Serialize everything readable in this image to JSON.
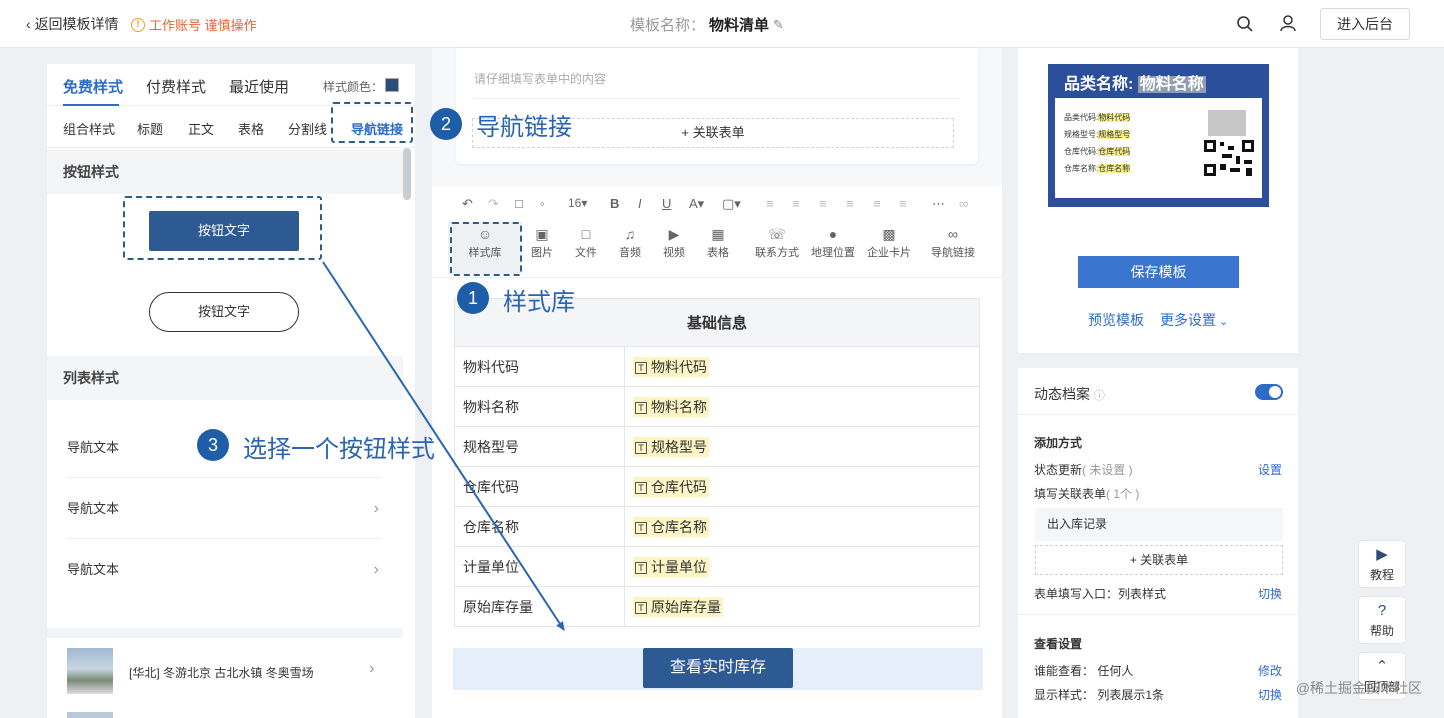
{
  "topbar": {
    "back_label": "返回模板详情",
    "warning_text": "工作账号 谨慎操作",
    "template_name_label": "模板名称：",
    "template_name": "物料清单",
    "enter_button": "进入后台"
  },
  "left_panel": {
    "tabs": [
      "免费样式",
      "付费样式",
      "最近使用"
    ],
    "style_color_label": "样式颜色：",
    "subtabs": [
      "组合样式",
      "标题",
      "正文",
      "表格",
      "分割线",
      "导航链接"
    ],
    "button_section_title": "按钮样式",
    "button_filled_label": "按钮文字",
    "button_outline_label": "按钮文字",
    "list_section_title": "列表样式",
    "nav_items": [
      "导航文本",
      "导航文本",
      "导航文本"
    ],
    "news_item": "[华北] 冬游北京 古北水镇 冬奥雪场"
  },
  "middle": {
    "hint_text": "请仔细填写表单中的内容",
    "add_linked_form": "+ 关联表单",
    "font_size": "16",
    "tools": [
      "样式库",
      "图片",
      "文件",
      "音频",
      "视频",
      "表格",
      "联系方式",
      "地理位置",
      "企业卡片",
      "导航链接"
    ],
    "table_title": "基础信息",
    "rows": [
      {
        "key": "物料代码",
        "value": "物料代码"
      },
      {
        "key": "物料名称",
        "value": "物料名称"
      },
      {
        "key": "规格型号",
        "value": "规格型号"
      },
      {
        "key": "仓库代码",
        "value": "仓库代码"
      },
      {
        "key": "仓库名称",
        "value": "仓库名称"
      },
      {
        "key": "计量单位",
        "value": "计量单位"
      },
      {
        "key": "原始库存量",
        "value": "原始库存量"
      }
    ],
    "query_button": "查看实时库存"
  },
  "right_panel": {
    "label_title": "品类名称:",
    "label_title_value": "物料名称",
    "label_lines": [
      {
        "k": "品类代码:",
        "v": "物料代码"
      },
      {
        "k": "规格型号:",
        "v": "规格型号"
      },
      {
        "k": "仓库代码:",
        "v": "仓库代码"
      },
      {
        "k": "仓库名称:",
        "v": "仓库名称"
      }
    ],
    "save_button": "保存模板",
    "preview_link": "预览模板",
    "more_settings": "更多设置",
    "dynamic_archive": "动态档案",
    "add_method": "添加方式",
    "status_update": "状态更新",
    "status_update_note": "( 未设置 )",
    "status_update_action": "设置",
    "fill_linked_form": "填写关联表单",
    "fill_linked_count": "( 1个 )",
    "linked_record": "出入库记录",
    "add_linked_form": "+ 关联表单",
    "form_entry": "表单填写入口：列表样式",
    "form_entry_action": "切换",
    "view_settings": "查看设置",
    "who_can_view": "谁能查看：  任何人",
    "who_can_view_action": "修改",
    "display_style": "显示样式：  列表展示1条",
    "display_style_action": "切换"
  },
  "floating": {
    "tutorial": "教程",
    "help": "帮助",
    "top": "回顶部"
  },
  "annotations": {
    "step1_num": "1",
    "step1_text": "样式库",
    "step2_num": "2",
    "step2_text": "导航链接",
    "step3_num": "3",
    "step3_text": "选择一个按钮样式"
  },
  "watermark": "@稀土掘金技术社区",
  "colors": {
    "accent": "#2f6bc9",
    "dark_button": "#2e5a93",
    "annotation": "#1e5ea9",
    "warning": "#e6643b"
  }
}
